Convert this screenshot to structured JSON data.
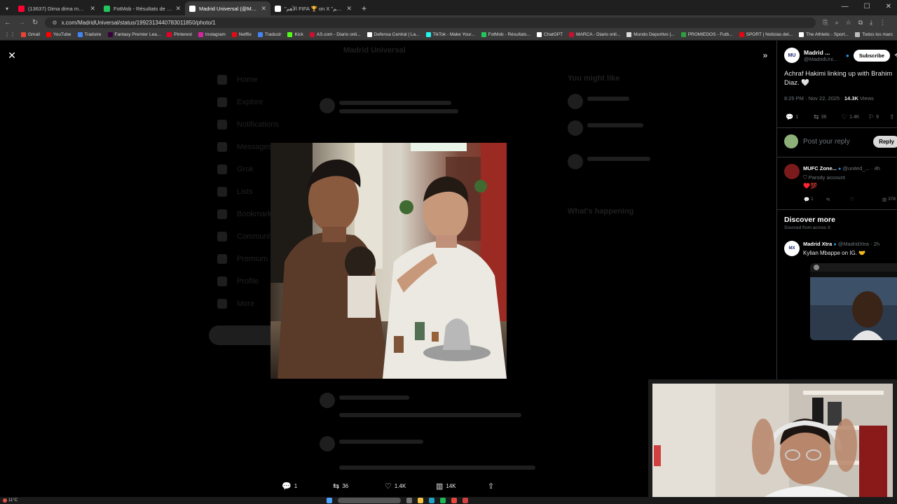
{
  "browser": {
    "tabs": [
      {
        "title": "(13637) Dima dima maghr...",
        "fav_color": "#ff0033",
        "active": false
      },
      {
        "title": "FotMob - Résultats de football",
        "fav_color": "#24c55e",
        "active": false
      },
      {
        "title": "Madrid Universal (@MadridUni...",
        "fav_color": "#ffffff",
        "active": true
      },
      {
        "title": "\"الأهم FIFA 🏆 on X \"كأس العالم",
        "fav_color": "#ffffff",
        "active": false
      }
    ],
    "new_tab": "+",
    "url": "x.com/MadridUniversal/status/1992313440783011850/photo/1",
    "bookmarks": [
      {
        "label": "Gmail",
        "color": "#ea4335"
      },
      {
        "label": "YouTube",
        "color": "#ff0000"
      },
      {
        "label": "Traduire",
        "color": "#4285f4"
      },
      {
        "label": "Fantasy Premier Lea...",
        "color": "#37003c"
      },
      {
        "label": "Pinterest",
        "color": "#e60023"
      },
      {
        "label": "Instagram",
        "color": "#d6249f"
      },
      {
        "label": "Netflix",
        "color": "#e50914"
      },
      {
        "label": "Traducir",
        "color": "#4285f4"
      },
      {
        "label": "Kick",
        "color": "#53fc18"
      },
      {
        "label": "AS.com - Diario onli...",
        "color": "#c8102e"
      },
      {
        "label": "Defensa Central | La...",
        "color": "#ffffff"
      },
      {
        "label": "TikTok - Make Your...",
        "color": "#25f4ee"
      },
      {
        "label": "FotMob - Résultats...",
        "color": "#24c55e"
      },
      {
        "label": "ChatGPT",
        "color": "#ffffff"
      },
      {
        "label": "MARCA - Diario onli...",
        "color": "#c8102e"
      },
      {
        "label": "Mundo Deportivo |...",
        "color": "#dddddd"
      },
      {
        "label": "PROMIEDOS - Futb...",
        "color": "#2e9e3e"
      },
      {
        "label": "SPORT | Noticias del...",
        "color": "#e30613"
      },
      {
        "label": "The Athletic - Sport...",
        "color": "#ffffff"
      }
    ],
    "all_bookmarks": "Todos los marc"
  },
  "viewer": {
    "bottom_actions": {
      "replies": "1",
      "reposts": "36",
      "likes": "1.4K",
      "views": "14K"
    }
  },
  "background": {
    "header": "Madrid Universal",
    "nav": [
      "Home",
      "Explore",
      "Notifications",
      "Messages",
      "Grok",
      "Lists",
      "Bookmarks",
      "Communities",
      "Premium",
      "Profile",
      "More"
    ],
    "you_might_like": "You might like",
    "whats_happening": "What's happening"
  },
  "panel": {
    "account_name": "Madrid ...",
    "account_handle": "@MadridUni...",
    "avatar_text": "MU",
    "subscribe": "Subscribe",
    "tweet_text": "Achraf Hakimi linking up with Brahim Diaz. 🤍",
    "time": "8:25 PM · Nov 22, 2025 · ",
    "views_count": "14.3K",
    "views_label": " Views",
    "stats": {
      "replies": "1",
      "reposts": "36",
      "likes": "1.4K",
      "bookmarks": "9"
    },
    "reply_placeholder": "Post your reply",
    "reply_button": "Reply",
    "comment": {
      "name": "MUFC Zone...",
      "handle": "@united_...",
      "time": "· 4h",
      "parody": "Parody account",
      "text": "♥️💯",
      "replies": "1",
      "views": "378"
    },
    "discover_title": "Discover more",
    "discover_sub": "Sourced from across X",
    "discover": {
      "name": "Madrid Xtra",
      "handle": "@MadridXtra",
      "time": "· 2h",
      "avatar_text": "MX",
      "text": "Kylian Mbappe on IG. 🤝"
    }
  },
  "taskbar": {
    "temperature": "11°C"
  }
}
